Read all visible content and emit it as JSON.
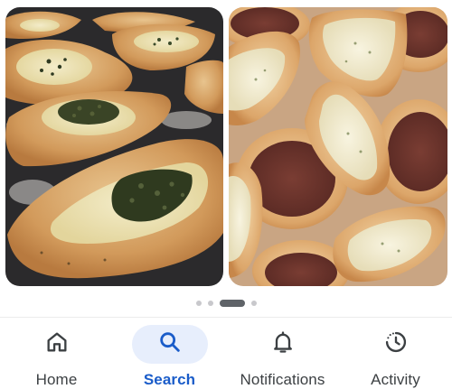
{
  "gallery": {
    "images": [
      {
        "alt": ""
      },
      {
        "alt": ""
      }
    ],
    "pager": {
      "count": 4,
      "active_index": 2
    }
  },
  "bottom_nav": {
    "items": [
      {
        "label": "Home",
        "icon": "home-icon",
        "selected": false
      },
      {
        "label": "Search",
        "icon": "search-icon",
        "selected": true
      },
      {
        "label": "Notifications",
        "icon": "bell-icon",
        "selected": false
      },
      {
        "label": "Activity",
        "icon": "activity-icon",
        "selected": false
      }
    ]
  },
  "colors": {
    "accent": "#1a5cc9",
    "selected_pill": "#e7eefc",
    "nav_text": "#3c4043",
    "pager_active": "#5f6368",
    "pager_inactive": "#c8c8cc"
  }
}
